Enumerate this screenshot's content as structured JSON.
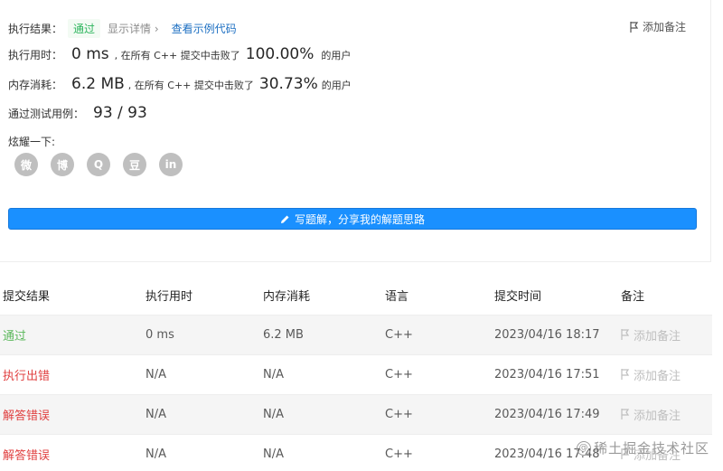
{
  "summary": {
    "result_label": "执行结果：",
    "result_value": "通过",
    "detail_link": "显示详情 ›",
    "sample_link": "查看示例代码",
    "add_note": "添加备注",
    "time_label": "执行用时：",
    "time_value": "0 ms",
    "time_text": ", 在所有 C++ 提交中击败了",
    "time_percent": "100.00%",
    "time_suffix": "的用户",
    "mem_label": "内存消耗：",
    "mem_value": "6.2 MB",
    "mem_text": ", 在所有 C++ 提交中击败了",
    "mem_percent": "30.73%",
    "mem_suffix": "的用户",
    "tests_label": "通过测试用例：",
    "tests_value": "93 / 93",
    "share_label": "炫耀一下:",
    "social_icons": [
      "wechat-icon",
      "weibo-icon",
      "qq-icon",
      "douban-icon",
      "linkedin-icon"
    ],
    "social_glyphs": [
      "微",
      "博",
      "Q",
      "豆",
      "in"
    ],
    "solve_button": "写题解，分享我的解题思路"
  },
  "table": {
    "headers": [
      "提交结果",
      "执行用时",
      "内存消耗",
      "语言",
      "提交时间",
      "备注"
    ],
    "rows": [
      {
        "status": "通过",
        "time": "0 ms",
        "memory": "6.2 MB",
        "lang": "C++",
        "submitted": "2023/04/16 18:17",
        "note": "添加备注"
      },
      {
        "status": "执行出错",
        "time": "N/A",
        "memory": "N/A",
        "lang": "C++",
        "submitted": "2023/04/16 17:51",
        "note": "添加备注"
      },
      {
        "status": "解答错误",
        "time": "N/A",
        "memory": "N/A",
        "lang": "C++",
        "submitted": "2023/04/16 17:49",
        "note": "添加备注"
      },
      {
        "status": "解答错误",
        "time": "N/A",
        "memory": "N/A",
        "lang": "C++",
        "submitted": "2023/04/16 17:48",
        "note": "添加备注"
      }
    ]
  },
  "watermark": "稀土掘金技术社区",
  "colors": {
    "primary": "#1a90ff",
    "pass": "#5cb85c",
    "error": "#e04040"
  }
}
